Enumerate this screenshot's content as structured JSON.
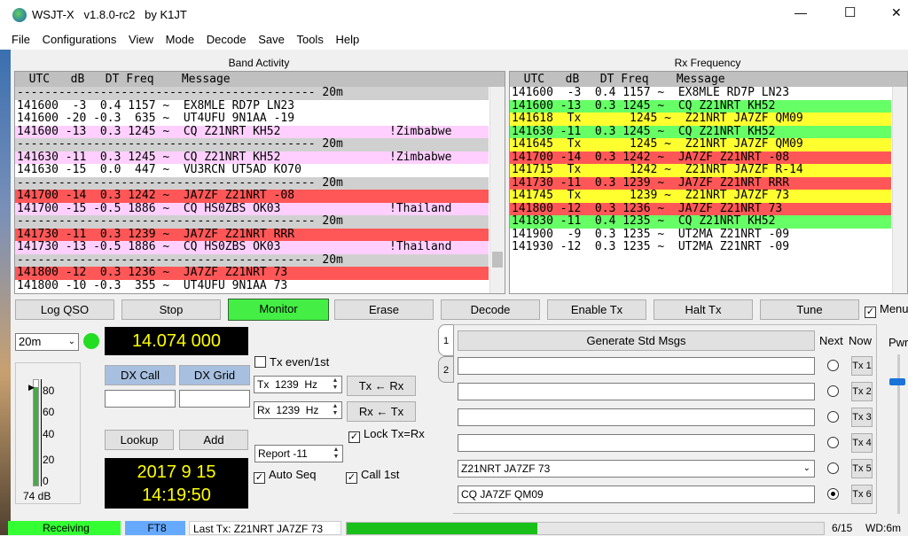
{
  "window": {
    "title": "WSJT-X   v1.8.0-rc2   by K1JT",
    "controls": {
      "minimize": "—",
      "maximize": "☐",
      "close": "✕"
    }
  },
  "menu": [
    "File",
    "Configurations",
    "View",
    "Mode",
    "Decode",
    "Save",
    "Tools",
    "Help"
  ],
  "band_activity": {
    "title": "Band Activity",
    "header": "  UTC   dB   DT Freq    Message",
    "rows": [
      {
        "text": "------------------------------------------- 20m",
        "style": "sep"
      },
      {
        "text": "141600  -3  0.4 1157 ~  EX8MLE RD7P LN23",
        "style": ""
      },
      {
        "text": "141600 -20 -0.3  635 ~  UT4UFU 9N1AA -19",
        "style": ""
      },
      {
        "text": "141600 -13  0.3 1245 ~  CQ Z21NRT KH52",
        "style": "pink",
        "country": "!Zimbabwe"
      },
      {
        "text": "------------------------------------------- 20m",
        "style": "sep"
      },
      {
        "text": "141630 -11  0.3 1245 ~  CQ Z21NRT KH52",
        "style": "pink",
        "country": "!Zimbabwe"
      },
      {
        "text": "141630 -15  0.0  447 ~  VU3RCN UT5AD KO70",
        "style": ""
      },
      {
        "text": "------------------------------------------- 20m",
        "style": "sep"
      },
      {
        "text": "141700 -14  0.3 1242 ~  JA7ZF Z21NRT -08",
        "style": "red"
      },
      {
        "text": "141700 -15 -0.5 1886 ~  CQ HS0ZBS OK03",
        "style": "pink",
        "country": "!Thailand"
      },
      {
        "text": "------------------------------------------- 20m",
        "style": "sep"
      },
      {
        "text": "141730 -11  0.3 1239 ~  JA7ZF Z21NRT RRR",
        "style": "red"
      },
      {
        "text": "141730 -13 -0.5 1886 ~  CQ HS0ZBS OK03",
        "style": "pink",
        "country": "!Thailand"
      },
      {
        "text": "------------------------------------------- 20m",
        "style": "sep"
      },
      {
        "text": "141800 -12  0.3 1236 ~  JA7ZF Z21NRT 73",
        "style": "red"
      },
      {
        "text": "141800 -10 -0.3  355 ~  UT4UFU 9N1AA 73",
        "style": ""
      }
    ]
  },
  "rx_frequency": {
    "title": "Rx Frequency",
    "header": "  UTC   dB   DT Freq    Message",
    "rows": [
      {
        "text": "141600  -3  0.4 1157 ~  EX8MLE RD7P LN23",
        "style": ""
      },
      {
        "text": "141600 -13  0.3 1245 ~  CQ Z21NRT KH52",
        "style": "green"
      },
      {
        "text": "141618  Tx       1245 ~  Z21NRT JA7ZF QM09",
        "style": "yellow"
      },
      {
        "text": "141630 -11  0.3 1245 ~  CQ Z21NRT KH52",
        "style": "green"
      },
      {
        "text": "141645  Tx       1245 ~  Z21NRT JA7ZF QM09",
        "style": "yellow"
      },
      {
        "text": "141700 -14  0.3 1242 ~  JA7ZF Z21NRT -08",
        "style": "red"
      },
      {
        "text": "141715  Tx       1242 ~  Z21NRT JA7ZF R-14",
        "style": "yellow"
      },
      {
        "text": "141730 -11  0.3 1239 ~  JA7ZF Z21NRT RRR",
        "style": "red"
      },
      {
        "text": "141745  Tx       1239 ~  Z21NRT JA7ZF 73",
        "style": "yellow"
      },
      {
        "text": "141800 -12  0.3 1236 ~  JA7ZF Z21NRT 73",
        "style": "red"
      },
      {
        "text": "141830 -11  0.4 1235 ~  CQ Z21NRT KH52",
        "style": "green"
      },
      {
        "text": "141900  -9  0.3 1235 ~  UT2MA Z21NRT -09",
        "style": ""
      },
      {
        "text": "141930 -12  0.3 1235 ~  UT2MA Z21NRT -09",
        "style": ""
      }
    ]
  },
  "buttons": {
    "log_qso": "Log QSO",
    "stop": "Stop",
    "monitor": "Monitor",
    "erase": "Erase",
    "decode": "Decode",
    "enable_tx": "Enable Tx",
    "halt_tx": "Halt Tx",
    "tune": "Tune",
    "menus": "Menus"
  },
  "band_select": "20m",
  "frequency_display": "14.074 000",
  "dx_call_label": "DX Call",
  "dx_grid_label": "DX Grid",
  "dx_call_value": "",
  "dx_grid_value": "",
  "lookup": "Lookup",
  "add": "Add",
  "date_display": "2017 9 15",
  "time_display": "14:19:50",
  "meter": {
    "ticks": [
      "80",
      "60",
      "40",
      "20",
      "0"
    ],
    "level_db": "74 dB",
    "level_fraction": 0.93
  },
  "tx_even": "Tx even/1st",
  "tx_freq": "Tx  1239  Hz",
  "rx_freq": "Rx  1239  Hz",
  "tx_from_rx": "Tx ← Rx",
  "rx_from_tx": "Rx ← Tx",
  "lock_tx_rx": "Lock Tx=Rx",
  "report": "Report -11",
  "auto_seq": "Auto Seq",
  "call_1st": "Call 1st",
  "tabs": [
    "1",
    "2"
  ],
  "generate_std_msgs": "Generate Std Msgs",
  "next_label": "Next",
  "now_label": "Now",
  "pwr_label": "Pwr",
  "tx_messages": [
    {
      "value": "",
      "btn": "Tx 1",
      "selected": false
    },
    {
      "value": "",
      "btn": "Tx 2",
      "selected": false
    },
    {
      "value": "",
      "btn": "Tx 3",
      "selected": false
    },
    {
      "value": "",
      "btn": "Tx 4",
      "selected": false
    },
    {
      "value": "Z21NRT JA7ZF 73",
      "btn": "Tx 5",
      "selected": false
    },
    {
      "value": "CQ JA7ZF QM09",
      "btn": "Tx 6",
      "selected": true
    }
  ],
  "status": {
    "receiving": "Receiving",
    "mode": "FT8",
    "last_tx": "Last Tx: Z21NRT JA7ZF 73",
    "progress_fraction": 0.4,
    "period": "6/15",
    "wd": "WD:6m"
  },
  "colors": {
    "monitor_green": "#44ee44",
    "receiving_green": "#33ff33",
    "mode_blue": "#66aaff",
    "progress_green": "#19c019",
    "freq_bg": "#000000",
    "freq_fg": "#ffff00"
  }
}
